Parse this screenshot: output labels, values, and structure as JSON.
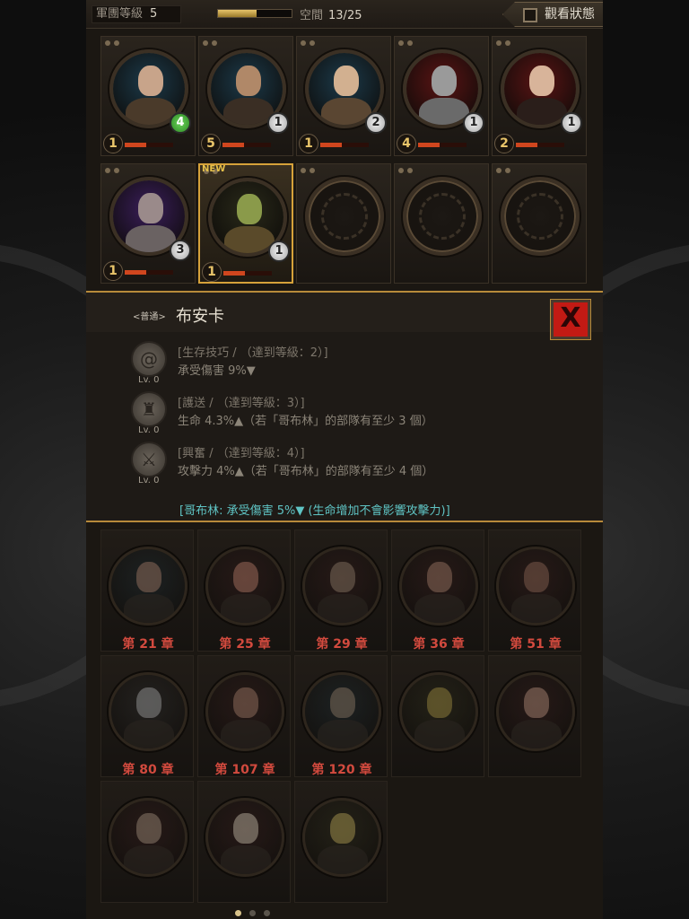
{
  "topbar": {
    "army_level_label": "軍團等級",
    "army_level_value": "5",
    "space_label": "空間",
    "space_value": "13/25",
    "space_progress": 0.52,
    "view_status_label": "觀看狀態"
  },
  "squad": [
    {
      "level": "1",
      "count": "4",
      "count_color": "green",
      "bg": "#1c3a4a",
      "skin": "#c8a48a",
      "cloth": "#4a3a2a",
      "hp": 0.45
    },
    {
      "level": "5",
      "count": "1",
      "count_color": "silver",
      "bg": "#1c3a4a",
      "skin": "#b08868",
      "cloth": "#3a2e24",
      "hp": 0.45
    },
    {
      "level": "1",
      "count": "2",
      "count_color": "silver",
      "bg": "#1c3a4a",
      "skin": "#d2b090",
      "cloth": "#5a4632",
      "hp": 0.45
    },
    {
      "level": "4",
      "count": "1",
      "count_color": "silver",
      "bg": "#5a1414",
      "skin": "#9a9a9a",
      "cloth": "#6a6a6a",
      "hp": 0.45
    },
    {
      "level": "2",
      "count": "1",
      "count_color": "silver",
      "bg": "#5a1414",
      "skin": "#d8b49a",
      "cloth": "#2a1e1a",
      "hp": 0.45
    },
    {
      "level": "1",
      "count": "3",
      "count_color": "silver",
      "bg": "#3a1e5a",
      "skin": "#9a8a8a",
      "cloth": "#6a6262",
      "hp": 0.45
    },
    {
      "level": "1",
      "count": "1",
      "count_color": "silver",
      "bg": "#2a2a1a",
      "skin": "#8a9a4a",
      "cloth": "#5a4a2a",
      "hp": 0.45,
      "new": "NEW",
      "selected": true
    }
  ],
  "detail": {
    "rarity": "<普通>",
    "name": "布安卡",
    "close_label": "X",
    "skills": [
      {
        "icon": "spiral-icon",
        "glyph": "@",
        "level": "Lv. 0",
        "name": "[生存技巧 / （達到等級：2）]",
        "effect": "承受傷害 9%▼"
      },
      {
        "icon": "helmet-icon",
        "glyph": "♜",
        "level": "Lv. 0",
        "name": "[護送 / （達到等級：3）]",
        "effect": "生命 4.3%▲（若「哥布林」的部隊有至少 3 個）"
      },
      {
        "icon": "sword-icon",
        "glyph": "⚔",
        "level": "Lv. 0",
        "name": "[興奮 / （達到等級：4）]",
        "effect": "攻擊力 4%▲（若「哥布林」的部隊有至少 4 個）"
      }
    ],
    "synergy": "[哥布林: 承受傷害 5%▼ (生命增加不會影響攻擊力)]"
  },
  "roster": [
    {
      "chapter": "第 21 章",
      "bg": "#1c2a30",
      "skin": "#8a6a5a"
    },
    {
      "chapter": "第 25 章",
      "bg": "#301a1a",
      "skin": "#9a6a5a"
    },
    {
      "chapter": "第 29 章",
      "bg": "#301a1a",
      "skin": "#7a6a5a"
    },
    {
      "chapter": "第 36 章",
      "bg": "#301a1a",
      "skin": "#8a6a5a"
    },
    {
      "chapter": "第 51 章",
      "bg": "#301a1a",
      "skin": "#7a5a4a"
    },
    {
      "chapter": "第 80 章",
      "bg": "#2a2a2a",
      "skin": "#8a8a8a"
    },
    {
      "chapter": "第 107 章",
      "bg": "#301a1a",
      "skin": "#8a6a5a"
    },
    {
      "chapter": "第 120 章",
      "bg": "#1c2a30",
      "skin": "#7a6a5a"
    },
    {
      "chapter": "",
      "bg": "#2a2a1a",
      "skin": "#8a7a3a"
    },
    {
      "chapter": "",
      "bg": "#301a1a",
      "skin": "#9a7a6a"
    },
    {
      "chapter": "",
      "bg": "#301a1a",
      "skin": "#8a7a6a"
    },
    {
      "chapter": "",
      "bg": "#301a1a",
      "skin": "#aaa090"
    },
    {
      "chapter": "",
      "bg": "#2a2a1a",
      "skin": "#9a8a4a"
    }
  ],
  "pagination": {
    "count": 3,
    "active": 0
  }
}
